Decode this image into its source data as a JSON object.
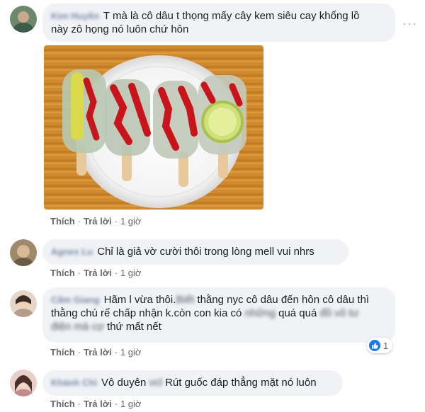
{
  "comments": [
    {
      "author": "Kim Huyền",
      "text_line1": "T mà là cô dâu t thọng mấy cây kem siêu cay khổng lồ",
      "text_line2": "này zô họng nó luôn chứ hôn",
      "actions": {
        "like": "Thích",
        "reply": "Trả lời",
        "time": "1 giờ"
      }
    },
    {
      "author": "Agnes Lu",
      "text": "Chỉ là giả vờ cười thôi trong lòng mell vui nhrs",
      "actions": {
        "like": "Thích",
        "reply": "Trả lời",
        "time": "1 giờ"
      }
    },
    {
      "author": "Cẩm Giang",
      "line1_a": "Hãm l vừa thôi.",
      "line1_blur": "Biết",
      "line1_b": " thằng nyc cô dâu đến hôn cô dâu thì",
      "line2_a": "thằng chú rể chấp nhận k.còn con kia có ",
      "line2_blur1": "những",
      "line2_b": " quá quá ",
      "line2_blur2": "đồ vô tư",
      "line3_blur": "điện mà cợ",
      "line3_b": " thứ mất nết",
      "reaction_count": "1",
      "actions": {
        "like": "Thích",
        "reply": "Trả lời",
        "time": "1 giờ"
      }
    },
    {
      "author": "Khánh Chi",
      "text_a": "Vô duyên ",
      "text_blur": "vcl",
      "text_b": " Rút guốc đáp thẳng mặt nó luôn",
      "actions": {
        "like": "Thích",
        "reply": "Trả lời",
        "time": "1 giờ"
      }
    }
  ],
  "icons": {
    "more": "more-options-icon",
    "like_reaction": "like-reaction-icon"
  },
  "colors": {
    "bubble": "#f0f2f5",
    "author": "#7b8ba8",
    "meta": "#65676b",
    "like_blue": "#1877f2"
  }
}
